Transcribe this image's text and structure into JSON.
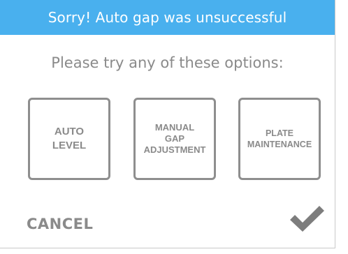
{
  "colors": {
    "accent": "#49b0ee",
    "muted_text": "#8a8a8a",
    "option_border": "#8e8e8e"
  },
  "dialog": {
    "title": "Sorry! Auto gap was unsuccessful",
    "prompt": "Please try any of these options:",
    "options": [
      {
        "label": "AUTO\nLEVEL"
      },
      {
        "label": "MANUAL\nGAP\nADJUSTMENT"
      },
      {
        "label": "PLATE\nMAINTENANCE"
      }
    ],
    "cancel_label": "CANCEL",
    "confirm_icon": "checkmark-icon"
  }
}
